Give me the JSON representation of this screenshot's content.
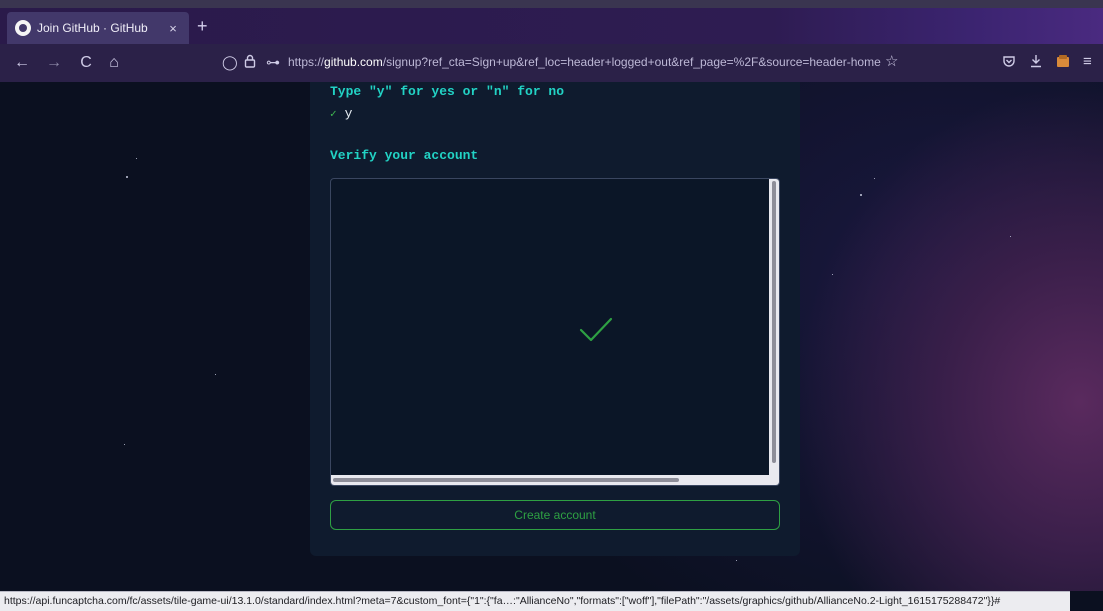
{
  "browser": {
    "tab": {
      "title": "Join GitHub · GitHub",
      "close_label": "×"
    },
    "new_tab_label": "+",
    "url": {
      "scheme": "https://",
      "host": "github.com",
      "path": "/signup?ref_cta=Sign+up&ref_loc=header+logged+out&ref_page=%2F&source=header-home"
    },
    "icons": {
      "back": "←",
      "forward": "→",
      "reload": "C",
      "home": "⌂",
      "shield": "◯",
      "lock": "🔒",
      "key": "⊶",
      "bookmark_star": "☆",
      "pocket": "◡",
      "download": "⤓",
      "extension": "▦",
      "menu": "≡"
    },
    "status_bar": "https://api.funcaptcha.com/fc/assets/tile-game-ui/13.1.0/standard/index.html?meta=7&custom_font={\"1\":{\"fa…:\"AllianceNo\",\"formats\":[\"woff\"],\"filePath\":\"/assets/graphics/github/AllianceNo.2-Light_1615175288472\"}}#"
  },
  "signup": {
    "prompt": "Type \"y\" for yes or \"n\" for no",
    "answer_check": "✓",
    "answer": "y",
    "verify_title": "Verify your account",
    "create_account_label": "Create account"
  },
  "colors": {
    "accent_cyan": "#22d3c5",
    "success_green": "#2ea043",
    "card_bg": "#0f1b2e"
  }
}
